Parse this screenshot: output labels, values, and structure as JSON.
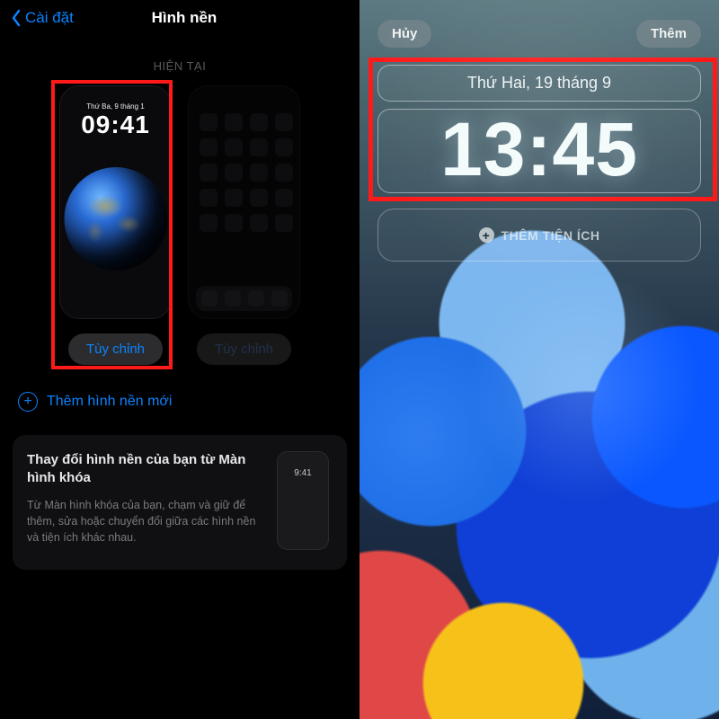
{
  "left": {
    "back_label": "Cài đặt",
    "title": "Hình nền",
    "section_label": "HIỆN TẠI",
    "lock_preview": {
      "date": "Thứ Ba, 9 tháng 1",
      "time": "09:41"
    },
    "customize_btn": "Tùy chỉnh",
    "customize_btn2": "Tùy chỉnh",
    "add_new_label": "Thêm hình nền mới",
    "tip": {
      "title": "Thay đổi hình nền của bạn từ Màn hình khóa",
      "body": "Từ Màn hình khóa của bạn, chạm và giữ để thêm, sửa hoặc chuyển đổi giữa các hình nền và tiện ích khác nhau.",
      "mini_time": "9:41"
    }
  },
  "right": {
    "cancel_label": "Hủy",
    "add_label": "Thêm",
    "date": "Thứ Hai, 19 tháng 9",
    "time": "13:45",
    "add_widget_label": "THÊM TIỆN ÍCH"
  }
}
